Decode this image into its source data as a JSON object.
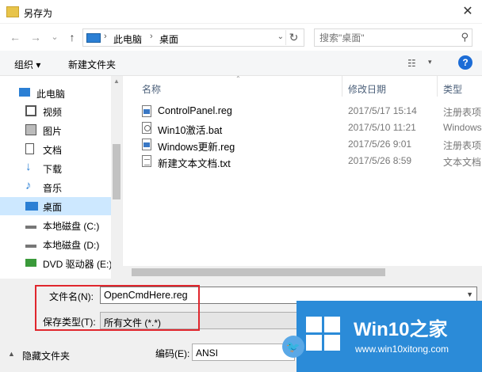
{
  "window": {
    "title": "另存为",
    "close": "✕"
  },
  "nav": {
    "back": "←",
    "forward": "→",
    "dropdown": "⌄",
    "up": "↑",
    "breadcrumb": [
      "此电脑",
      "桌面"
    ],
    "separator": "›",
    "refresh": "↻",
    "search_placeholder": "搜索\"桌面\""
  },
  "toolbar": {
    "organize": "组织 ▾",
    "new_folder": "新建文件夹",
    "view": "☷",
    "view_drop": "▾",
    "help": "?"
  },
  "sidebar": {
    "items": [
      {
        "label": "此电脑",
        "icon": "computer-icon",
        "color": "#2b7fd4"
      },
      {
        "label": "视频",
        "icon": "video-icon",
        "color": "#555555"
      },
      {
        "label": "图片",
        "icon": "pictures-icon",
        "color": "#555555"
      },
      {
        "label": "文档",
        "icon": "documents-icon",
        "color": "#555555"
      },
      {
        "label": "下载",
        "icon": "downloads-icon",
        "color": "#2b7fd4"
      },
      {
        "label": "音乐",
        "icon": "music-icon",
        "color": "#2b7fd4"
      },
      {
        "label": "桌面",
        "icon": "desktop-icon",
        "color": "#2b7fd4",
        "selected": true
      },
      {
        "label": "本地磁盘 (C:)",
        "icon": "drive-c-icon",
        "color": "#777777"
      },
      {
        "label": "本地磁盘 (D:)",
        "icon": "drive-d-icon",
        "color": "#777777"
      },
      {
        "label": "DVD 驱动器 (E:)",
        "icon": "dvd-drive-icon",
        "color": "#3a9a3a"
      }
    ]
  },
  "columns": {
    "name": "名称",
    "date": "修改日期",
    "type": "类型"
  },
  "files": [
    {
      "name": "ControlPanel.reg",
      "date": "2017/5/17 15:14",
      "type": "注册表项",
      "kind": "reg"
    },
    {
      "name": "Win10激活.bat",
      "date": "2017/5/10 11:21",
      "type": "Windows",
      "kind": "bat"
    },
    {
      "name": "Windows更新.reg",
      "date": "2017/5/26 9:01",
      "type": "注册表项",
      "kind": "reg"
    },
    {
      "name": "新建文本文档.txt",
      "date": "2017/5/26 8:59",
      "type": "文本文档",
      "kind": "txt"
    }
  ],
  "save": {
    "filename_label": "文件名(N):",
    "filename_value": "OpenCmdHere.reg",
    "filetype_label": "保存类型(T):",
    "filetype_value": "所有文件  (*.*)",
    "hide_folders": "隐藏文件夹",
    "encoding_label": "编码(E):",
    "encoding_value": "ANSI"
  },
  "watermark": {
    "title": "Win10之家",
    "url": "www.win10xitong.com",
    "bird": "🐦"
  },
  "colors": {
    "accent": "#2b8bd8",
    "highlight": "#cde8ff",
    "red_frame": "#e0262d"
  }
}
